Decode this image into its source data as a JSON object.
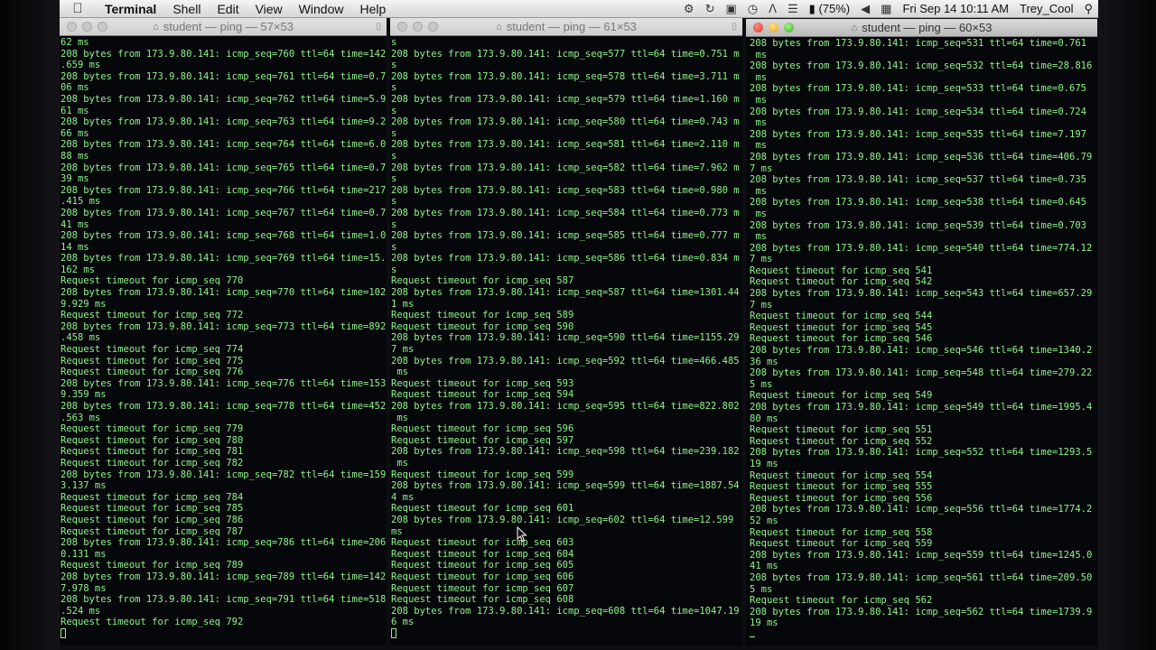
{
  "menubar": {
    "app": "Terminal",
    "items": [
      "Shell",
      "Edit",
      "View",
      "Window",
      "Help"
    ],
    "battery": "(75%)",
    "clock": "Fri Sep 14  10:11 AM",
    "user": "Trey_Cool"
  },
  "windows": [
    {
      "title": "student — ping — 57×53",
      "active": false,
      "lines": [
        "62 ms",
        "208 bytes from 173.9.80.141: icmp_seq=760 ttl=64 time=142",
        ".659 ms",
        "208 bytes from 173.9.80.141: icmp_seq=761 ttl=64 time=0.7",
        "06 ms",
        "208 bytes from 173.9.80.141: icmp_seq=762 ttl=64 time=5.9",
        "61 ms",
        "208 bytes from 173.9.80.141: icmp_seq=763 ttl=64 time=9.2",
        "66 ms",
        "208 bytes from 173.9.80.141: icmp_seq=764 ttl=64 time=6.0",
        "88 ms",
        "208 bytes from 173.9.80.141: icmp_seq=765 ttl=64 time=0.7",
        "39 ms",
        "208 bytes from 173.9.80.141: icmp_seq=766 ttl=64 time=217",
        ".415 ms",
        "208 bytes from 173.9.80.141: icmp_seq=767 ttl=64 time=0.7",
        "41 ms",
        "208 bytes from 173.9.80.141: icmp_seq=768 ttl=64 time=1.0",
        "14 ms",
        "208 bytes from 173.9.80.141: icmp_seq=769 ttl=64 time=15.",
        "162 ms",
        "Request timeout for icmp_seq 770",
        "208 bytes from 173.9.80.141: icmp_seq=770 ttl=64 time=102",
        "9.929 ms",
        "Request timeout for icmp_seq 772",
        "208 bytes from 173.9.80.141: icmp_seq=773 ttl=64 time=892",
        ".458 ms",
        "Request timeout for icmp_seq 774",
        "Request timeout for icmp_seq 775",
        "Request timeout for icmp_seq 776",
        "208 bytes from 173.9.80.141: icmp_seq=776 ttl=64 time=153",
        "9.359 ms",
        "208 bytes from 173.9.80.141: icmp_seq=778 ttl=64 time=452",
        ".563 ms",
        "Request timeout for icmp_seq 779",
        "Request timeout for icmp_seq 780",
        "Request timeout for icmp_seq 781",
        "Request timeout for icmp_seq 782",
        "208 bytes from 173.9.80.141: icmp_seq=782 ttl=64 time=159",
        "3.137 ms",
        "Request timeout for icmp_seq 784",
        "Request timeout for icmp_seq 785",
        "Request timeout for icmp_seq 786",
        "Request timeout for icmp_seq 787",
        "208 bytes from 173.9.80.141: icmp_seq=786 ttl=64 time=206",
        "0.131 ms",
        "Request timeout for icmp_seq 789",
        "208 bytes from 173.9.80.141: icmp_seq=789 ttl=64 time=142",
        "7.978 ms",
        "208 bytes from 173.9.80.141: icmp_seq=791 ttl=64 time=518",
        ".524 ms",
        "Request timeout for icmp_seq 792"
      ]
    },
    {
      "title": "student — ping — 61×53",
      "active": false,
      "lines": [
        "s",
        "208 bytes from 173.9.80.141: icmp_seq=577 ttl=64 time=0.751 m",
        "s",
        "208 bytes from 173.9.80.141: icmp_seq=578 ttl=64 time=3.711 m",
        "s",
        "208 bytes from 173.9.80.141: icmp_seq=579 ttl=64 time=1.160 m",
        "s",
        "208 bytes from 173.9.80.141: icmp_seq=580 ttl=64 time=0.743 m",
        "s",
        "208 bytes from 173.9.80.141: icmp_seq=581 ttl=64 time=2.110 m",
        "s",
        "208 bytes from 173.9.80.141: icmp_seq=582 ttl=64 time=7.962 m",
        "s",
        "208 bytes from 173.9.80.141: icmp_seq=583 ttl=64 time=0.980 m",
        "s",
        "208 bytes from 173.9.80.141: icmp_seq=584 ttl=64 time=0.773 m",
        "s",
        "208 bytes from 173.9.80.141: icmp_seq=585 ttl=64 time=0.777 m",
        "s",
        "208 bytes from 173.9.80.141: icmp_seq=586 ttl=64 time=0.834 m",
        "s",
        "Request timeout for icmp_seq 587",
        "208 bytes from 173.9.80.141: icmp_seq=587 ttl=64 time=1301.44",
        "1 ms",
        "Request timeout for icmp_seq 589",
        "Request timeout for icmp_seq 590",
        "208 bytes from 173.9.80.141: icmp_seq=590 ttl=64 time=1155.29",
        "7 ms",
        "208 bytes from 173.9.80.141: icmp_seq=592 ttl=64 time=466.485",
        " ms",
        "Request timeout for icmp_seq 593",
        "Request timeout for icmp_seq 594",
        "208 bytes from 173.9.80.141: icmp_seq=595 ttl=64 time=822.802",
        " ms",
        "Request timeout for icmp_seq 596",
        "Request timeout for icmp_seq 597",
        "208 bytes from 173.9.80.141: icmp_seq=598 ttl=64 time=239.182",
        " ms",
        "Request timeout for icmp_seq 599",
        "208 bytes from 173.9.80.141: icmp_seq=599 ttl=64 time=1887.54",
        "4 ms",
        "Request timeout for icmp_seq 601",
        "208 bytes from 173.9.80.141: icmp_seq=602 ttl=64 time=12.599",
        "ms",
        "Request timeout for icmp_seq 603",
        "Request timeout for icmp_seq 604",
        "Request timeout for icmp_seq 605",
        "Request timeout for icmp_seq 606",
        "Request timeout for icmp_seq 607",
        "Request timeout for icmp_seq 608",
        "208 bytes from 173.9.80.141: icmp_seq=608 ttl=64 time=1047.19",
        "6 ms"
      ]
    },
    {
      "title": "student — ping — 60×53",
      "active": true,
      "lines": [
        "208 bytes from 173.9.80.141: icmp_seq=531 ttl=64 time=0.761",
        " ms",
        "208 bytes from 173.9.80.141: icmp_seq=532 ttl=64 time=28.816",
        " ms",
        "208 bytes from 173.9.80.141: icmp_seq=533 ttl=64 time=0.675",
        " ms",
        "208 bytes from 173.9.80.141: icmp_seq=534 ttl=64 time=0.724",
        " ms",
        "208 bytes from 173.9.80.141: icmp_seq=535 ttl=64 time=7.197",
        " ms",
        "208 bytes from 173.9.80.141: icmp_seq=536 ttl=64 time=406.79",
        "7 ms",
        "208 bytes from 173.9.80.141: icmp_seq=537 ttl=64 time=0.735",
        " ms",
        "208 bytes from 173.9.80.141: icmp_seq=538 ttl=64 time=0.645",
        " ms",
        "208 bytes from 173.9.80.141: icmp_seq=539 ttl=64 time=0.703",
        " ms",
        "208 bytes from 173.9.80.141: icmp_seq=540 ttl=64 time=774.12",
        "7 ms",
        "Request timeout for icmp_seq 541",
        "Request timeout for icmp_seq 542",
        "208 bytes from 173.9.80.141: icmp_seq=543 ttl=64 time=657.29",
        "7 ms",
        "Request timeout for icmp_seq 544",
        "Request timeout for icmp_seq 545",
        "Request timeout for icmp_seq 546",
        "208 bytes from 173.9.80.141: icmp_seq=546 ttl=64 time=1340.2",
        "36 ms",
        "208 bytes from 173.9.80.141: icmp_seq=548 ttl=64 time=279.22",
        "5 ms",
        "Request timeout for icmp_seq 549",
        "208 bytes from 173.9.80.141: icmp_seq=549 ttl=64 time=1995.4",
        "80 ms",
        "Request timeout for icmp_seq 551",
        "Request timeout for icmp_seq 552",
        "208 bytes from 173.9.80.141: icmp_seq=552 ttl=64 time=1293.5",
        "19 ms",
        "Request timeout for icmp_seq 554",
        "Request timeout for icmp_seq 555",
        "Request timeout for icmp_seq 556",
        "208 bytes from 173.9.80.141: icmp_seq=556 ttl=64 time=1774.2",
        "52 ms",
        "Request timeout for icmp_seq 558",
        "Request timeout for icmp_seq 559",
        "208 bytes from 173.9.80.141: icmp_seq=559 ttl=64 time=1245.0",
        "41 ms",
        "208 bytes from 173.9.80.141: icmp_seq=561 ttl=64 time=209.50",
        "5 ms",
        "Request timeout for icmp_seq 562",
        "208 bytes from 173.9.80.141: icmp_seq=562 ttl=64 time=1739.9",
        "19 ms"
      ]
    }
  ],
  "colors": {
    "terminal_text": "#8ef58a",
    "terminal_bg": "#06070a",
    "menubar_bg": "#e6e6e6"
  }
}
